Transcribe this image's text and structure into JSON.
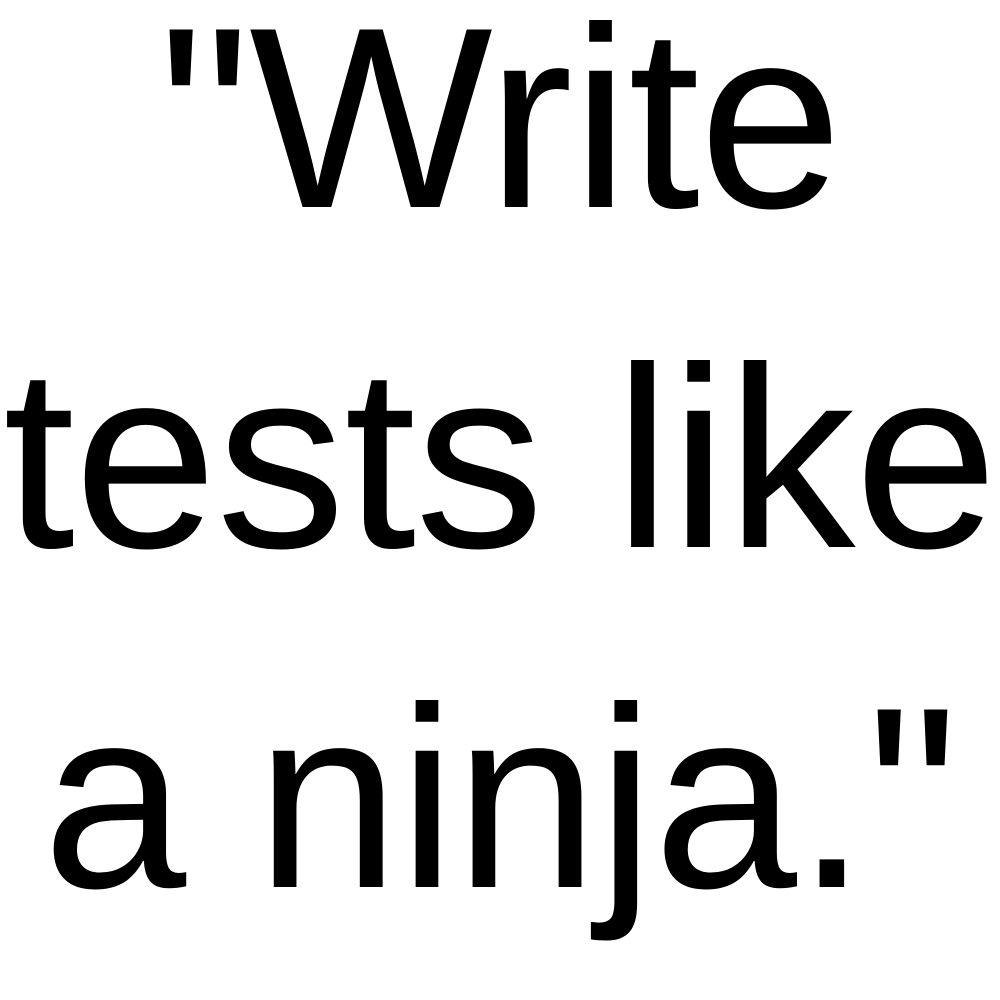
{
  "quote": {
    "lines": [
      "\"Write",
      "tests like",
      "a ninja.\""
    ]
  },
  "colors": {
    "text": "#000000",
    "background": "#ffffff"
  }
}
